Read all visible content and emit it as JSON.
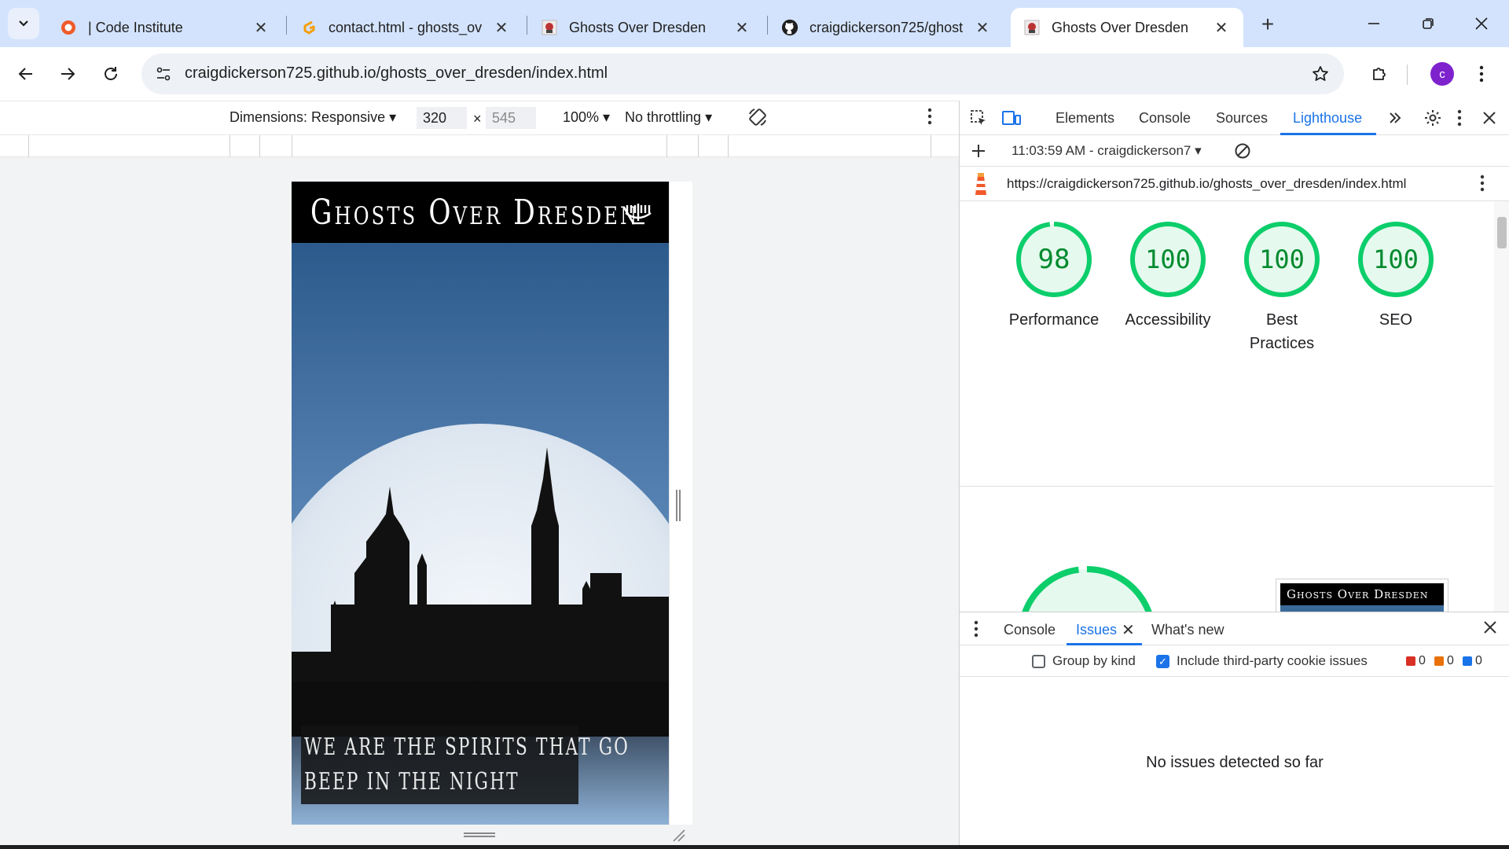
{
  "tabs": [
    {
      "label": "| Code Institute",
      "icon": "code-institute-icon"
    },
    {
      "label": "contact.html - ghosts_ov",
      "icon": "gitpod-icon"
    },
    {
      "label": "Ghosts Over Dresden",
      "icon": "ghost-favicon"
    },
    {
      "label": "craigdickerson725/ghost",
      "icon": "github-icon"
    },
    {
      "label": "Ghosts Over Dresden",
      "icon": "ghost-favicon",
      "active": true
    }
  ],
  "address": {
    "url": "craigdickerson725.github.io/ghosts_over_dresden/index.html"
  },
  "profile": {
    "initial": "c",
    "color": "#7e22ce"
  },
  "device_toolbar": {
    "dimensions_label": "Dimensions: Responsive",
    "width_value": "320",
    "times": "×",
    "height_value": "545",
    "zoom": "100%",
    "throttling": "No throttling"
  },
  "emulated_page": {
    "title": "Ghosts Over Dresden",
    "caption_line1": "We are the spirits that go",
    "caption_line2": "beep in the night"
  },
  "devtools": {
    "tabs": [
      "Elements",
      "Console",
      "Sources",
      "Lighthouse"
    ],
    "active_tab": "Lighthouse",
    "report_time": "11:03:59 AM - craigdickerson7",
    "report_url": "https://craigdickerson725.github.io/ghosts_over_dresden/index.html",
    "scores": [
      {
        "label": "Performance",
        "score": "98"
      },
      {
        "label": "Accessibility",
        "score": "100"
      },
      {
        "label": "Best Practices",
        "score": "100"
      },
      {
        "label": "SEO",
        "score": "100"
      }
    ],
    "big_score": "98",
    "thumbnail_title": "Ghosts Over Dresden",
    "drawer_tabs": [
      "Console",
      "Issues",
      "What's new"
    ],
    "drawer_active": "Issues",
    "group_by_kind": "Group by kind",
    "include_third_party": "Include third-party cookie issues",
    "counts": [
      "0",
      "0",
      "0"
    ],
    "no_issues": "No issues detected so far"
  },
  "colors": {
    "accent": "#1a73e8",
    "score_green": "#0cce6b",
    "score_text": "#008a2e"
  }
}
